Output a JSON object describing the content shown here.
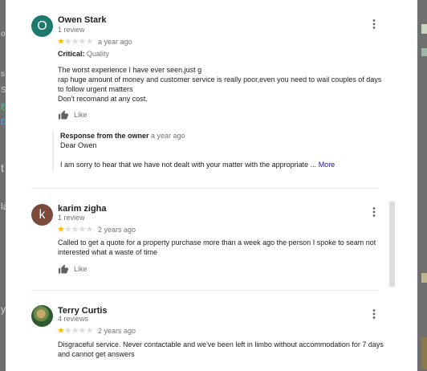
{
  "reviews": [
    {
      "avatar_letter": "O",
      "avatar_color": "#1b7a6d",
      "name": "Owen Stark",
      "count": "1 review",
      "rating": 1,
      "stars_on": "★",
      "stars_off": "★★★★",
      "time": "a year ago",
      "tag_label": "Critical:",
      "tag_value": "Quality",
      "text": [
        "The worst experience I have ever seen.just g",
        "rap huge amount of money and customer service is really poor,even you need to wail couples of days to follow urgent matters",
        "Don't recomand at any cost."
      ],
      "like_label": "Like",
      "owner_response": {
        "title": "Response from the owner",
        "time": "a year ago",
        "greeting": "Dear Owen",
        "body": "I am sorry to hear that we have not dealt with your matter with the appropriate ...",
        "more_label": "More"
      }
    },
    {
      "avatar_letter": "k",
      "avatar_color": "#7b4a3a",
      "name": "karim zigha",
      "count": "1 review",
      "rating": 1,
      "stars_on": "★",
      "stars_off": "★★★★",
      "time": "2 years ago",
      "text": "Called to get a quote for a property purchase more than a week ago the person I spoke to seam not interested what a waste of time",
      "like_label": "Like"
    },
    {
      "avatar_icon": "profile-photo",
      "name": "Terry Curtis",
      "count": "4 reviews",
      "rating": 1,
      "stars_on": "★",
      "stars_off": "★★★★",
      "time": "2 years ago",
      "text": "Disgraceful service. Never contactable and we've been left in limbo without accommodation for 7 days and cannot get answers"
    }
  ],
  "background_fragments": [
    "o",
    "s",
    "S",
    "s",
    "C",
    "D",
    "t",
    "la",
    "y"
  ],
  "colors": {
    "star": "#fbbc04",
    "star_empty": "#dadce0",
    "link": "#1a0dab",
    "muted": "#70757a"
  }
}
